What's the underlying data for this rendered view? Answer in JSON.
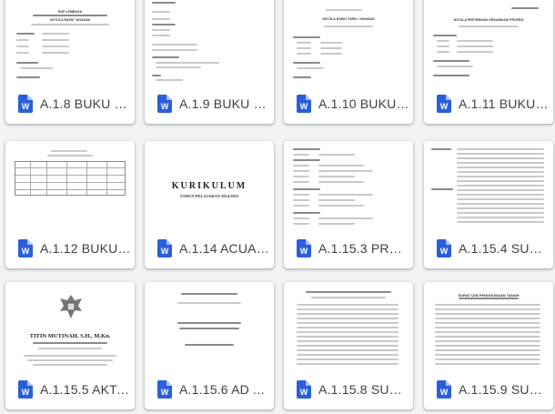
{
  "icon": {
    "name": "word-doc-icon",
    "color": "#2b5fd9"
  },
  "cards": [
    {
      "title": "A.1.8 BUKU NO...",
      "thumb": "minutes",
      "heading": "RUP LEMBAGA",
      "sub": "NOTULA RAPAT YAYASAN"
    },
    {
      "title": "A.1.9 BUKU NO...",
      "thumb": "notes"
    },
    {
      "title": "A.1.10 BUKU N...",
      "thumb": "minutes2",
      "heading": "NOTULA RAPAT GURU / YAYASAN"
    },
    {
      "title": "A.1.11 BUKU N...",
      "thumb": "minutes3",
      "heading": "NOTULA PERTEMUAN ORGANISASI PROFESI"
    },
    {
      "title": "A.1.12 BUKU KE...",
      "thumb": "table"
    },
    {
      "title": "A.1.14 ACUAN-...",
      "thumb": "kurikulum",
      "big": "KURIKULUM",
      "sub": "TAHUN PELAJARAN 2014/2015"
    },
    {
      "title": "A.1.15.3 PROFIL...",
      "thumb": "profile"
    },
    {
      "title": "A.1.15.4 SURAT...",
      "thumb": "decree"
    },
    {
      "title": "A.1.15.5 AKTA ...",
      "thumb": "akta",
      "name": "TITIN MUTINAH, S.H., M.Kn."
    },
    {
      "title": "A.1.15.6 AD AR...",
      "thumb": "ad"
    },
    {
      "title": "A.1.15.8 SURAT...",
      "thumb": "letter"
    },
    {
      "title": "A.1.15.9 SURAT...",
      "thumb": "land",
      "heading": "SURAT IZIN PENGGUNAAN TANAH"
    }
  ]
}
